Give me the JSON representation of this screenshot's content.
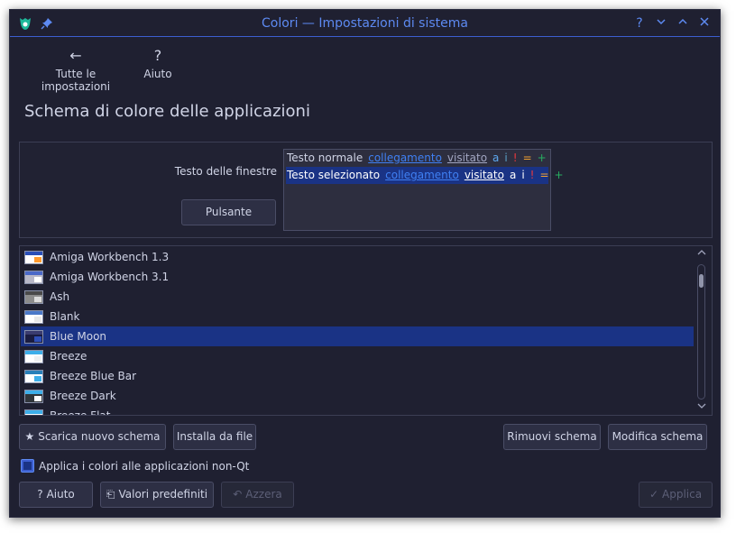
{
  "window": {
    "title": "Colori — Impostazioni di sistema",
    "title_buttons": [
      "?",
      "⌄",
      "^",
      "×"
    ]
  },
  "toolbar": {
    "back_label": "Tutte le impostazioni",
    "back_icon": "←",
    "help_label": "Aiuto",
    "help_icon": "?"
  },
  "page_title": "Schema di colore delle applicazioni",
  "preview": {
    "window_text_label": "Testo delle finestre",
    "button_label": "Pulsante",
    "normal_row": [
      "Testo normale",
      "collegamento",
      "visitato",
      "a",
      "i",
      "!",
      "=",
      "+"
    ],
    "selected_row": [
      "Testo selezionato",
      "collegamento",
      "visitato",
      "a",
      "i",
      "!",
      "=",
      "+"
    ]
  },
  "schemes": [
    {
      "name": "Amiga Workbench 1.3",
      "thumb": [
        "#ffffff",
        "#ff9a2e",
        "#2a4fb8"
      ]
    },
    {
      "name": "Amiga Workbench 3.1",
      "thumb": [
        "#b8b8c8",
        "#ffffff",
        "#4a68c8"
      ]
    },
    {
      "name": "Ash",
      "thumb": [
        "#8c8c8c",
        "#dcdcdc",
        "#4a4a4a"
      ]
    },
    {
      "name": "Blank",
      "thumb": [
        "#ffffff",
        "#e8e8e8",
        "#4a78c8"
      ]
    },
    {
      "name": "Blue Moon",
      "thumb": [
        "#1a1c40",
        "#2f4fb8",
        "#3a3c70"
      ]
    },
    {
      "name": "Breeze",
      "thumb": [
        "#ffffff",
        "#eff0f1",
        "#3daee9"
      ]
    },
    {
      "name": "Breeze Blue Bar",
      "thumb": [
        "#ffffff",
        "#3daee9",
        "#2980b9"
      ]
    },
    {
      "name": "Breeze Dark",
      "thumb": [
        "#31363b",
        "#ffffff",
        "#3daee9"
      ]
    },
    {
      "name": "Breeze Flat",
      "thumb": [
        "#ffffff",
        "#eff0f1",
        "#3daee9"
      ]
    }
  ],
  "selected_scheme": "Blue Moon",
  "actions": {
    "download_label": "Scarica nuovo schema",
    "install_label": "Installa da file",
    "remove_label": "Rimuovi schema",
    "edit_label": "Modifica schema"
  },
  "apply_nonqt": {
    "label": "Applica i colori alle applicazioni non-Qt",
    "checked": true
  },
  "footer": {
    "help_label": "Aiuto",
    "defaults_label": "Valori predefiniti",
    "reset_label": "Azzera",
    "apply_label": "Applica"
  },
  "colors": {
    "accent": "#3c5ed0",
    "title": "#5d8af2",
    "link": "#3f80f4",
    "visited": "#a1a5c1",
    "active_a": "#5da8f0",
    "inactive_i": "#5aa0c8",
    "negative": "#e8383d",
    "neutral": "#f0a030",
    "positive": "#27ae60"
  }
}
